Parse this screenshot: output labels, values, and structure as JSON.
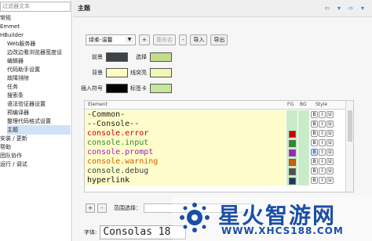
{
  "left": {
    "filter_placeholder": "过滤器文本",
    "items": [
      {
        "label": "常规",
        "level": 0
      },
      {
        "label": "Emmet",
        "level": 0
      },
      {
        "label": "HBuilder",
        "level": 0
      },
      {
        "label": "Web服务器",
        "level": 1
      },
      {
        "label": "边改边看浏览器宽度设",
        "level": 1
      },
      {
        "label": "编辑器",
        "level": 1
      },
      {
        "label": "代码助手设置",
        "level": 1
      },
      {
        "label": "故障排除",
        "level": 1
      },
      {
        "label": "任务",
        "level": 1
      },
      {
        "label": "搜索条",
        "level": 1
      },
      {
        "label": "语法验证器设置",
        "level": 1
      },
      {
        "label": "预编译器",
        "level": 1
      },
      {
        "label": "整理代码格式设置",
        "level": 1
      },
      {
        "label": "主题",
        "level": 1,
        "selected": true
      },
      {
        "label": "安装 / 更新",
        "level": 0
      },
      {
        "label": "帮助",
        "level": 0
      },
      {
        "label": "团队协作",
        "level": 0
      },
      {
        "label": "运行 / 调试",
        "level": 0
      }
    ]
  },
  "right": {
    "title": "主题",
    "nav_icons": [
      "back-arrow",
      "dropdown",
      "forward-arrow",
      "dropdown"
    ],
    "theme_select": "绿柔-温馨",
    "buttons": {
      "add": "+",
      "rename": "重命名",
      "remove": "-",
      "import": "导入",
      "export": "导出"
    },
    "colors": [
      {
        "label": "前景",
        "color": "#3f4346"
      },
      {
        "label": "选择",
        "color": "#c4dc8c"
      },
      {
        "label": "背景",
        "color": "#fffcc4"
      },
      {
        "label": "线突亮",
        "color": "#f1f5b8"
      },
      {
        "label": "插入符号",
        "color": "#000000"
      },
      {
        "label": "标签卡",
        "color": "#c6e79b"
      }
    ],
    "table": {
      "headers": {
        "element": "Element",
        "fg": "FG",
        "bg": "BG",
        "style": "Style"
      },
      "rows": [
        {
          "text": "-Common-",
          "color": "#222222",
          "fg": null
        },
        {
          "text": "--Console--",
          "color": "#222222",
          "fg": null
        },
        {
          "text": "console.error",
          "color": "#cc0000",
          "fg": "#cc0000"
        },
        {
          "text": "console.input",
          "color": "#2e8b2e",
          "fg": "#2e8b2e"
        },
        {
          "text": "console.prompt",
          "color": "#a020c0",
          "fg": "#a020c0"
        },
        {
          "text": "console.warning",
          "color": "#d06000",
          "fg": "#d06000"
        },
        {
          "text": "console.debug",
          "color": "#404040",
          "fg": "#505050"
        },
        {
          "text": "hyperlink",
          "color": "#111111",
          "fg": "#223366"
        }
      ],
      "style_buttons": [
        "B",
        "I",
        "U"
      ]
    },
    "scope_label": "范围选择：",
    "font_label": "字体:",
    "font_value": "Consolas 18"
  },
  "watermark": {
    "title": "星火智游网",
    "url": "WWW.XHCS188.COM"
  }
}
